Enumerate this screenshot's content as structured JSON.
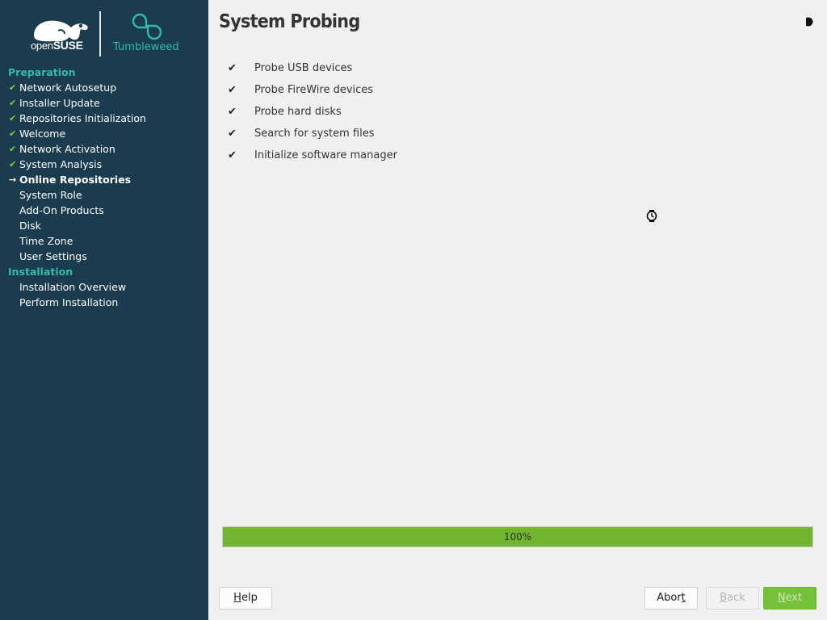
{
  "brand": {
    "opensuse_prefix": "open",
    "opensuse_suffix": "SUSE",
    "distro": "Tumbleweed",
    "colors": {
      "sidebar_bg": "#1b3c4e",
      "accent": "#35b9ab",
      "done_check": "#7ad33c",
      "progress": "#70b52e"
    }
  },
  "sidebar": {
    "sections": [
      {
        "title": "Preparation",
        "steps": [
          {
            "label": "Network Autosetup",
            "state": "done"
          },
          {
            "label": "Installer Update",
            "state": "done"
          },
          {
            "label": "Repositories Initialization",
            "state": "done"
          },
          {
            "label": "Welcome",
            "state": "done"
          },
          {
            "label": "Network Activation",
            "state": "done"
          },
          {
            "label": "System Analysis",
            "state": "done"
          },
          {
            "label": "Online Repositories",
            "state": "current"
          },
          {
            "label": "System Role",
            "state": "pending"
          },
          {
            "label": "Add-On Products",
            "state": "pending"
          },
          {
            "label": "Disk",
            "state": "pending"
          },
          {
            "label": "Time Zone",
            "state": "pending"
          },
          {
            "label": "User Settings",
            "state": "pending"
          }
        ]
      },
      {
        "title": "Installation",
        "steps": [
          {
            "label": "Installation Overview",
            "state": "pending"
          },
          {
            "label": "Perform Installation",
            "state": "pending"
          }
        ]
      }
    ],
    "icons": {
      "done": "checkmark-icon",
      "current": "arrow-right-icon"
    }
  },
  "main": {
    "title": "System Probing",
    "help_toggle_icon": "half-moon-icon",
    "probe_items": [
      {
        "label": "Probe USB devices",
        "done": true
      },
      {
        "label": "Probe FireWire devices",
        "done": true
      },
      {
        "label": "Probe hard disks",
        "done": true
      },
      {
        "label": "Search for system files",
        "done": true
      },
      {
        "label": "Initialize software manager",
        "done": true
      }
    ],
    "progress": {
      "percent": 100,
      "text": "100%"
    }
  },
  "buttons": {
    "help": {
      "label": "Help",
      "mnemonic": "H",
      "rest": "elp"
    },
    "abort": {
      "label": "Abort",
      "mnemonic": "t",
      "before": "Abor",
      "after": ""
    },
    "back": {
      "label": "Back",
      "mnemonic": "B",
      "rest": "ack",
      "enabled": false
    },
    "next": {
      "label": "Next",
      "mnemonic": "N",
      "rest": "ext",
      "enabled": false
    }
  }
}
